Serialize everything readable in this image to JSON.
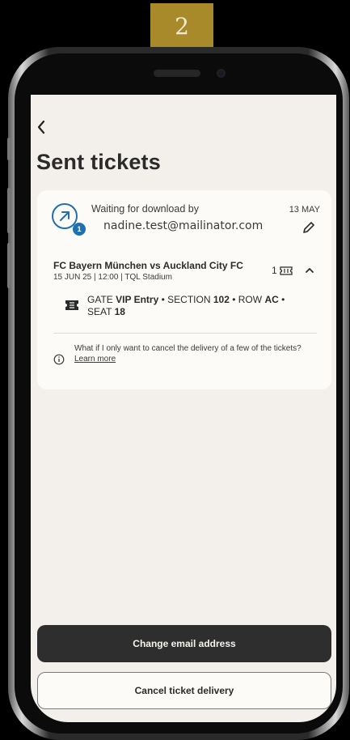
{
  "step_badge": "2",
  "screen": {
    "title": "Sent tickets",
    "back_icon": "chevron-left-icon"
  },
  "delivery": {
    "status_text": "Waiting for download by",
    "recipient_email": "nadine.test@mailinator.com",
    "date": "13 MAY",
    "status_count": "1",
    "event_title": "FC Bayern München vs Auckland City FC",
    "event_meta": "15 JUN 25 | 12:00 | TQL Stadium",
    "ticket_count": "1",
    "seat": {
      "gate_label": "GATE",
      "gate_value": "VIP Entry",
      "section_label": "SECTION",
      "section_value": "102",
      "row_label": "ROW",
      "row_value": "AC",
      "seat_label": "SEAT",
      "seat_value": "18"
    },
    "help_text": "What if I only want to cancel the delivery of a few of the tickets?",
    "learn_more": "Learn more"
  },
  "actions": {
    "change_email": "Change email address",
    "cancel_delivery": "Cancel ticket delivery"
  },
  "colors": {
    "badge": "#a88a2a",
    "accent_blue": "#1f6fb3",
    "primary_button": "#2e2e2e",
    "screen_bg": "#f3f0eb"
  }
}
